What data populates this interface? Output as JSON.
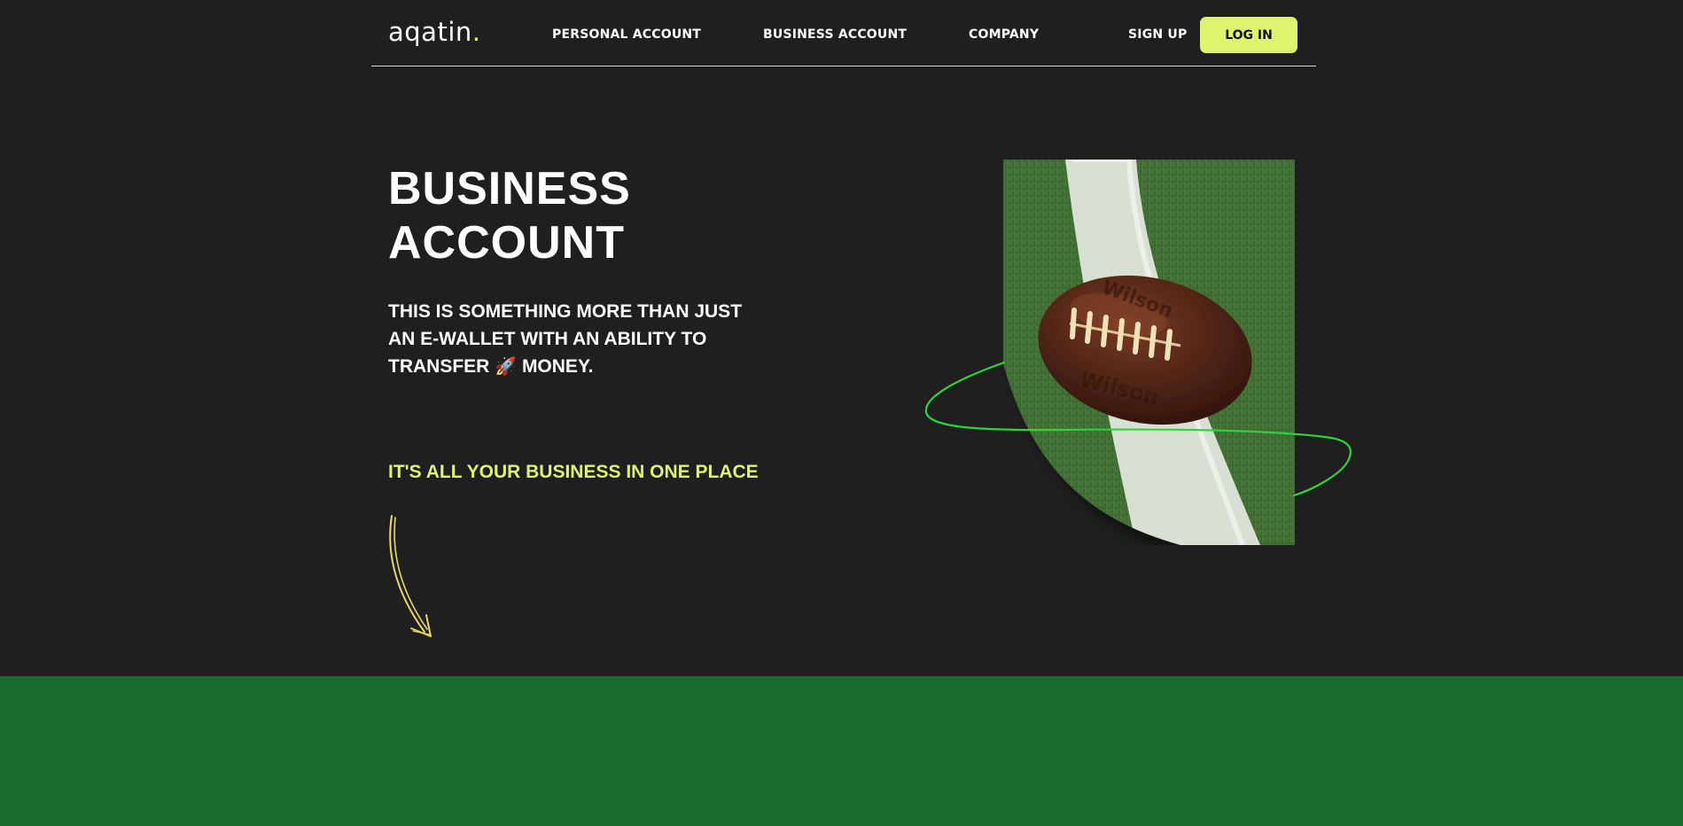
{
  "header": {
    "logo_text": "aqatin",
    "logo_dot": ".",
    "nav": {
      "personal": "PERSONAL ACCOUNT",
      "business": "BUSINESS ACCOUNT",
      "company": "COMPANY"
    },
    "signup_label": "SIGN UP",
    "login_label": "LOG IN"
  },
  "hero": {
    "title_line1": "BUSINESS",
    "title_line2": "ACCOUNT",
    "subtitle_line1": "THIS IS SOMETHING MORE THAN JUST",
    "subtitle_line2": "AN E-WALLET WITH AN ABILITY TO",
    "subtitle_line3_a": "TRANSFER",
    "subtitle_emoji": "🚀",
    "subtitle_line3_b": "MONEY.",
    "tagline": "IT'S ALL YOUR BUSINESS IN ONE PLACE"
  },
  "icons": {
    "arrow": "hand-drawn-arrow-icon",
    "rocket": "rocket-emoji"
  },
  "colors": {
    "background": "#1f1f1f",
    "accent": "#dff46e",
    "orbit": "#2ad63a",
    "band": "#1c6b2e"
  }
}
